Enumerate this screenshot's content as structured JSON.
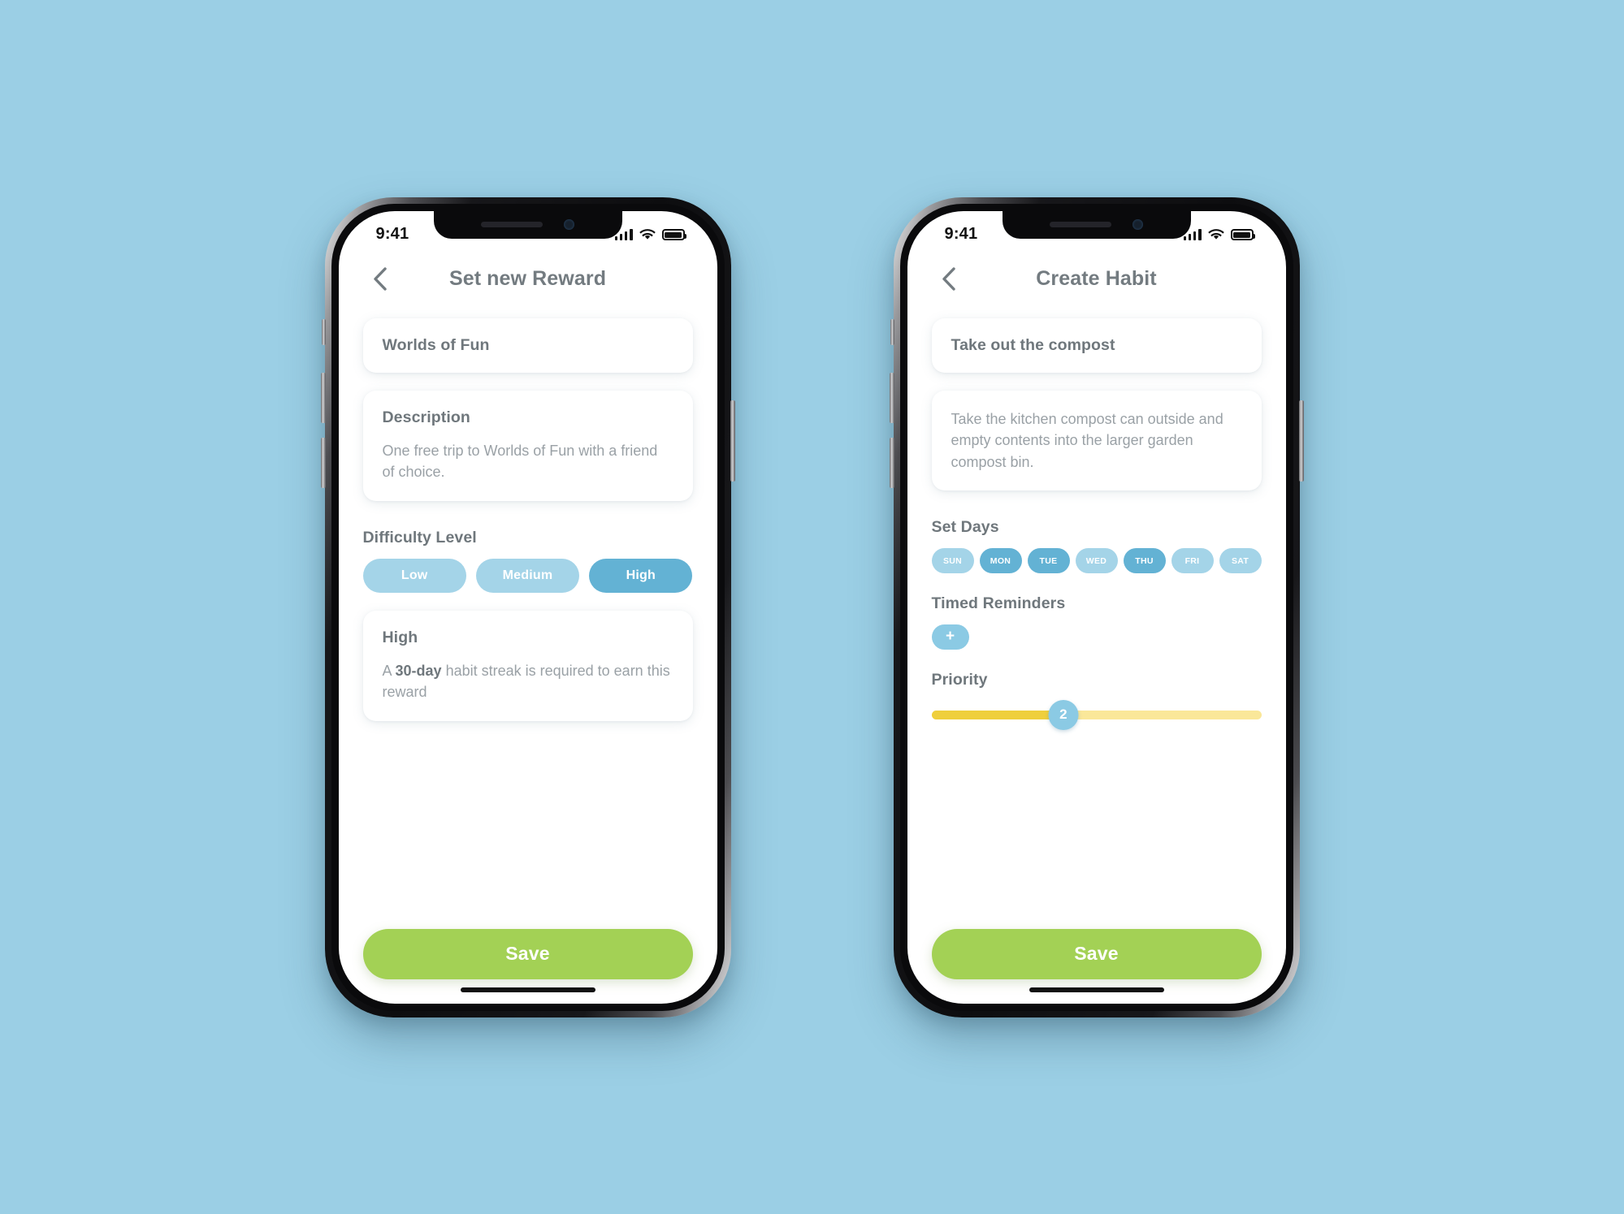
{
  "background_color": "#9BCFE5",
  "theme": {
    "accent_blue": "#63B2D4",
    "accent_blue_light": "#A4D4E8",
    "save_green": "#A3D155",
    "slider_fill": "#EFCF3C",
    "slider_track": "#FAE799",
    "heading_gray": "#6F777C",
    "body_gray": "#9AA1A6"
  },
  "screens": [
    {
      "id": "set-new-reward",
      "status_bar": {
        "time": "9:41",
        "icons": [
          "signal-icon",
          "wifi-icon",
          "battery-icon"
        ]
      },
      "nav": {
        "back_icon": "chevron-left-icon",
        "title": "Set new Reward"
      },
      "reward_name": {
        "value": "Worlds of Fun",
        "placeholder": "Reward name"
      },
      "description": {
        "label": "Description",
        "value": "One free trip to Worlds of Fun with a friend of choice.",
        "placeholder": "Describe the reward"
      },
      "difficulty": {
        "label": "Difficulty Level",
        "options": [
          "Low",
          "Medium",
          "High"
        ],
        "selected": "High"
      },
      "difficulty_info": {
        "title": "High",
        "text_before": "A ",
        "text_bold": "30-day",
        "text_after": " habit streak is required to earn this reward"
      },
      "save_label": "Save",
      "home_indicator": true
    },
    {
      "id": "create-habit",
      "status_bar": {
        "time": "9:41",
        "icons": [
          "signal-icon",
          "wifi-icon",
          "battery-icon"
        ]
      },
      "nav": {
        "back_icon": "chevron-left-icon",
        "title": "Create Habit"
      },
      "habit_name": {
        "value": "Take out the compost",
        "placeholder": "Habit name"
      },
      "description": {
        "value": "Take the kitchen compost can outside and empty contents into the larger garden compost bin.",
        "placeholder": "Describe the habit"
      },
      "set_days": {
        "label": "Set Days",
        "days": [
          {
            "label": "SUN",
            "selected": false
          },
          {
            "label": "MON",
            "selected": true
          },
          {
            "label": "TUE",
            "selected": true
          },
          {
            "label": "WED",
            "selected": false
          },
          {
            "label": "THU",
            "selected": true
          },
          {
            "label": "FRI",
            "selected": false
          },
          {
            "label": "SAT",
            "selected": false
          }
        ]
      },
      "timed_reminders": {
        "label": "Timed Reminders",
        "add_icon": "plus-icon",
        "add_label": "+"
      },
      "priority": {
        "label": "Priority",
        "value": "2",
        "min": 0,
        "max": 5,
        "percent": 40
      },
      "save_label": "Save",
      "home_indicator": true
    }
  ]
}
